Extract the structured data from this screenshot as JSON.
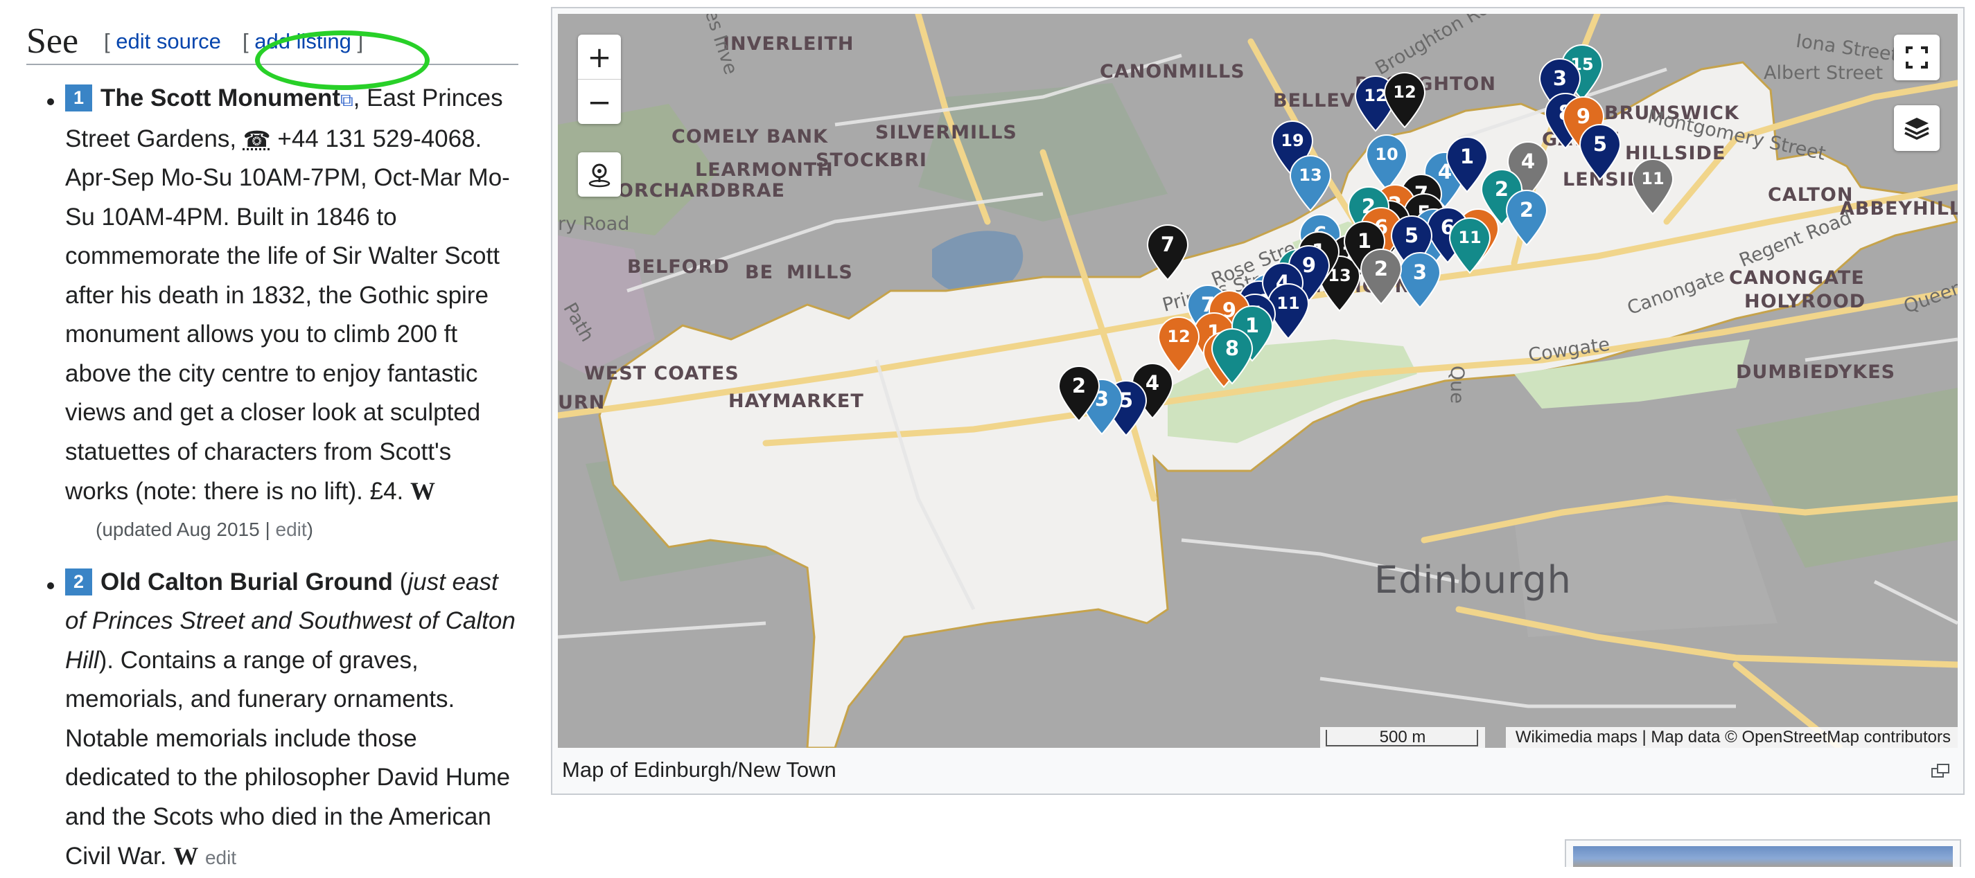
{
  "heading": {
    "title": "See",
    "edit_source": {
      "open": "[",
      "label": "edit source",
      "close": "]"
    },
    "add_listing": {
      "open": "[",
      "label": "add listing",
      "close": "]"
    }
  },
  "listings": [
    {
      "number": "1",
      "name": "The Scott Monument",
      "after_name": ", East Princes Street Gardens, ",
      "phone_icon": "☎",
      "phone": " +44 131 529-4068",
      "body": ". Apr-Sep Mo-Su 10AM-7PM, Oct-Mar Mo-Su 10AM-4PM. Built in 1846 to commemorate the life of Sir Walter Scott after his death in 1832, the Gothic spire monument allows you to climb 200 ft above the city centre to enjoy fantastic views and get a closer look at sculpted statuettes of characters from Scott's works (note: there is no lift). £4. ",
      "wikipedia_icon": "W",
      "updated": "(updated Aug 2015",
      "separator": "|",
      "edit": "edit",
      "updated_close": ")"
    },
    {
      "number": "2",
      "name": "Old Calton Burial Ground",
      "paren_open": " (",
      "directions": "just east of Princes Street and Southwest of Calton Hill",
      "body": "). Contains a range of graves, memorials, and funerary ornaments. Notable memorials include those dedicated to the philosopher David Hume and the Scots who died in the American Civil War. ",
      "wikipedia_icon": "W",
      "edit": "edit"
    }
  ],
  "map": {
    "zoom_in": "+",
    "zoom_out": "−",
    "scale": "500 m",
    "attribution": "Wikimedia maps | Map data © OpenStreetMap contributors",
    "caption": "Map of Edinburgh/New Town",
    "city": "Edinburgh",
    "districts": [
      "INVERLEITH",
      "CANONMILLS",
      "BROUGHTON",
      "BELLEVUE",
      "BRUNSWICK",
      "COMELY BANK",
      "SILVERMILLS",
      "GAYFIE",
      "HILLSIDE",
      "LEARMONTH",
      "STOCKBRI",
      "ORCHARDBRAE",
      "LENSIDE",
      "CALTON",
      "ABBEYHILL",
      "BELFORD",
      "BE",
      "MILLS",
      "CANONGATE",
      "HOLYROOD",
      "THE MOUND",
      "WEST COATES",
      "DUMBIEDYKES",
      "HAYMARKET",
      "URN"
    ],
    "streets": [
      "Iona Street",
      "Albert Street",
      "Broughton Ro",
      "Montgomery Street",
      "Regent Road",
      "Canongate",
      "Cowgate",
      "Queen's",
      "Princes Street",
      "Rose Stre",
      "ry Road",
      "tes Inve",
      "ue",
      "Path",
      "Que"
    ],
    "colors": {
      "navy": "#0b2470",
      "steel": "#3d8bc5",
      "teal": "#138a8a",
      "black": "#151515",
      "orange": "#e06c1f",
      "grey": "#777777"
    },
    "markers": [
      "15",
      "3",
      "8",
      "9",
      "5",
      "12",
      "12",
      "19",
      "10",
      "13",
      "11",
      "4",
      "4",
      "2",
      "2",
      "1",
      "3",
      "6",
      "7",
      "7",
      "2",
      "5",
      "4",
      "2",
      "6",
      "7",
      "6",
      "5",
      "11",
      "8",
      "13",
      "1",
      "1",
      "3",
      "2",
      "9",
      "1",
      "12",
      "4",
      "7",
      "11",
      "5",
      "7",
      "9",
      "1",
      "1",
      "12",
      "6",
      "8",
      "4",
      "5",
      "3",
      "2",
      "1"
    ]
  }
}
